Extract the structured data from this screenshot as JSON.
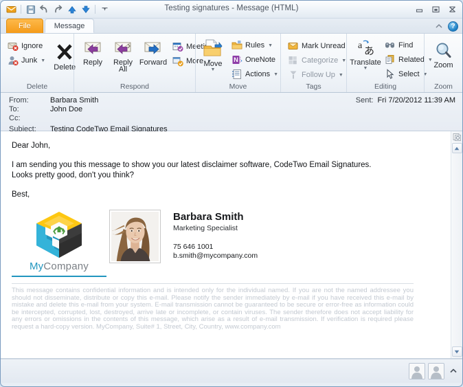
{
  "window": {
    "title": "Testing signatures  -  Message (HTML)",
    "minimize_label": "Minimize",
    "restore_label": "Restore",
    "close_label": "Close"
  },
  "quick_access": {
    "items": [
      {
        "name": "mail-icon",
        "tooltip": "Message"
      },
      {
        "name": "save-icon",
        "tooltip": "Save"
      },
      {
        "name": "undo-icon",
        "tooltip": "Undo"
      },
      {
        "name": "redo-icon",
        "tooltip": "Redo"
      },
      {
        "name": "previous-item-icon",
        "tooltip": "Previous Item"
      },
      {
        "name": "next-item-icon",
        "tooltip": "Next Item"
      },
      {
        "name": "customize-qat-icon",
        "tooltip": "Customize Quick Access Toolbar"
      }
    ]
  },
  "tabs": {
    "file": "File",
    "message": "Message",
    "collapse_ribbon": "Collapse the Ribbon",
    "help": "?"
  },
  "ribbon": {
    "groups": [
      {
        "label": "Delete",
        "items": [
          {
            "label": "Ignore",
            "icon": "ignore-icon"
          },
          {
            "label": "Junk",
            "icon": "junk-icon",
            "caret": true
          },
          {
            "label": "Delete",
            "icon": "delete-x-icon"
          }
        ]
      },
      {
        "label": "Respond",
        "items": [
          {
            "label": "Reply",
            "icon": "reply-icon"
          },
          {
            "label": "Reply\nAll",
            "icon": "reply-all-icon"
          },
          {
            "label": "Forward",
            "icon": "forward-icon"
          },
          {
            "label": "Meeting",
            "icon": "meeting-icon"
          },
          {
            "label": "More",
            "icon": "more-respond-icon",
            "caret": true
          }
        ]
      },
      {
        "label": "Move",
        "items": [
          {
            "label": "Move",
            "icon": "move-folder-icon",
            "caret": true
          },
          {
            "label": "Rules",
            "icon": "rules-icon",
            "caret": true
          },
          {
            "label": "OneNote",
            "icon": "onenote-icon"
          },
          {
            "label": "Actions",
            "icon": "actions-icon",
            "caret": true
          }
        ]
      },
      {
        "label": "Tags",
        "items": [
          {
            "label": "Mark Unread",
            "icon": "mark-unread-icon"
          },
          {
            "label": "Categorize",
            "icon": "categorize-icon",
            "caret": true,
            "dim": true
          },
          {
            "label": "Follow Up",
            "icon": "follow-up-icon",
            "caret": true,
            "dim": true
          }
        ]
      },
      {
        "label": "Editing",
        "items": [
          {
            "label": "Translate",
            "icon": "translate-icon",
            "caret": true
          },
          {
            "label": "Find",
            "icon": "find-icon"
          },
          {
            "label": "Related",
            "icon": "related-icon",
            "caret": true
          },
          {
            "label": "Select",
            "icon": "select-icon",
            "caret": true
          }
        ]
      },
      {
        "label": "Zoom",
        "items": [
          {
            "label": "Zoom",
            "icon": "zoom-magnifier-icon"
          }
        ]
      }
    ],
    "labels": {
      "delete": "Delete",
      "respond": "Respond",
      "move": "Move",
      "tags": "Tags",
      "editing": "Editing",
      "zoom": "Zoom"
    },
    "buttons": {
      "ignore": "Ignore",
      "junk": "Junk",
      "delete": "Delete",
      "reply": "Reply",
      "reply_all_line1": "Reply",
      "reply_all_line2": "All",
      "forward": "Forward",
      "meeting": "Meeting",
      "more": "More",
      "move": "Move",
      "rules": "Rules",
      "onenote": "OneNote",
      "actions": "Actions",
      "mark_unread": "Mark Unread",
      "categorize": "Categorize",
      "follow_up": "Follow Up",
      "translate": "Translate",
      "find": "Find",
      "related": "Related",
      "select": "Select",
      "zoom": "Zoom"
    }
  },
  "mail_header": {
    "from_label": "From:",
    "from_value": "Barbara Smith",
    "to_label": "To:",
    "to_value": "John Doe",
    "cc_label": "Cc:",
    "cc_value": "",
    "subject_label": "Subject:",
    "subject_value": "Testing CodeTwo Email Signatures",
    "sent_label": "Sent:",
    "sent_value": "Fri 7/20/2012 11:39 AM"
  },
  "body": {
    "greeting": "Dear John,",
    "paragraph1": "I am sending you this message to show you our latest disclaimer software, CodeTwo Email Signatures.",
    "paragraph2": "Looks pretty good, don't you think?",
    "closing": "Best,"
  },
  "signature": {
    "logo_my": "My",
    "logo_company": "Company",
    "photo_alt": "Barbara Smith portrait photo",
    "name": "Barbara Smith",
    "role": "Marketing Specialist",
    "phone": "75 646 1001",
    "email": "b.smith@mycompany.com",
    "disclaimer": "This message contains confidential information and is intended only for the individual named. If you are not the named addressee you should not disseminate, distribute or copy this e-mail. Please notify the sender immediately by e-mail if you have received this e-mail by mistake and delete this e-mail from your system. E-mail transmission cannot be guaranteed to be secure or error-free as information could be intercepted, corrupted, lost, destroyed, arrive late or incomplete, or contain viruses. The sender therefore does not accept liability for any errors or omissions in the contents of this message, which arise as a result of e-mail transmission. If verification is required please request a hard-copy version. MyCompany, Suite# 1, Street, City, Country, www.company.com"
  },
  "scrollbar": {
    "up_arrow": "▲",
    "down_arrow": "▼"
  },
  "status_bar": {
    "people_pane_1": "Contact photo",
    "people_pane_2": "Contact photo",
    "expand_chevron": "▲"
  },
  "colors": {
    "file_tab_orange": "#f59b19",
    "logo_teal": "#2196bf",
    "logo_yellow": "#fdc712",
    "logo_dark": "#3c3c3c",
    "logo_green": "#4a9b3c",
    "window_border": "#7a9bbf",
    "disclaimer_grey": "#c3c9d1"
  }
}
